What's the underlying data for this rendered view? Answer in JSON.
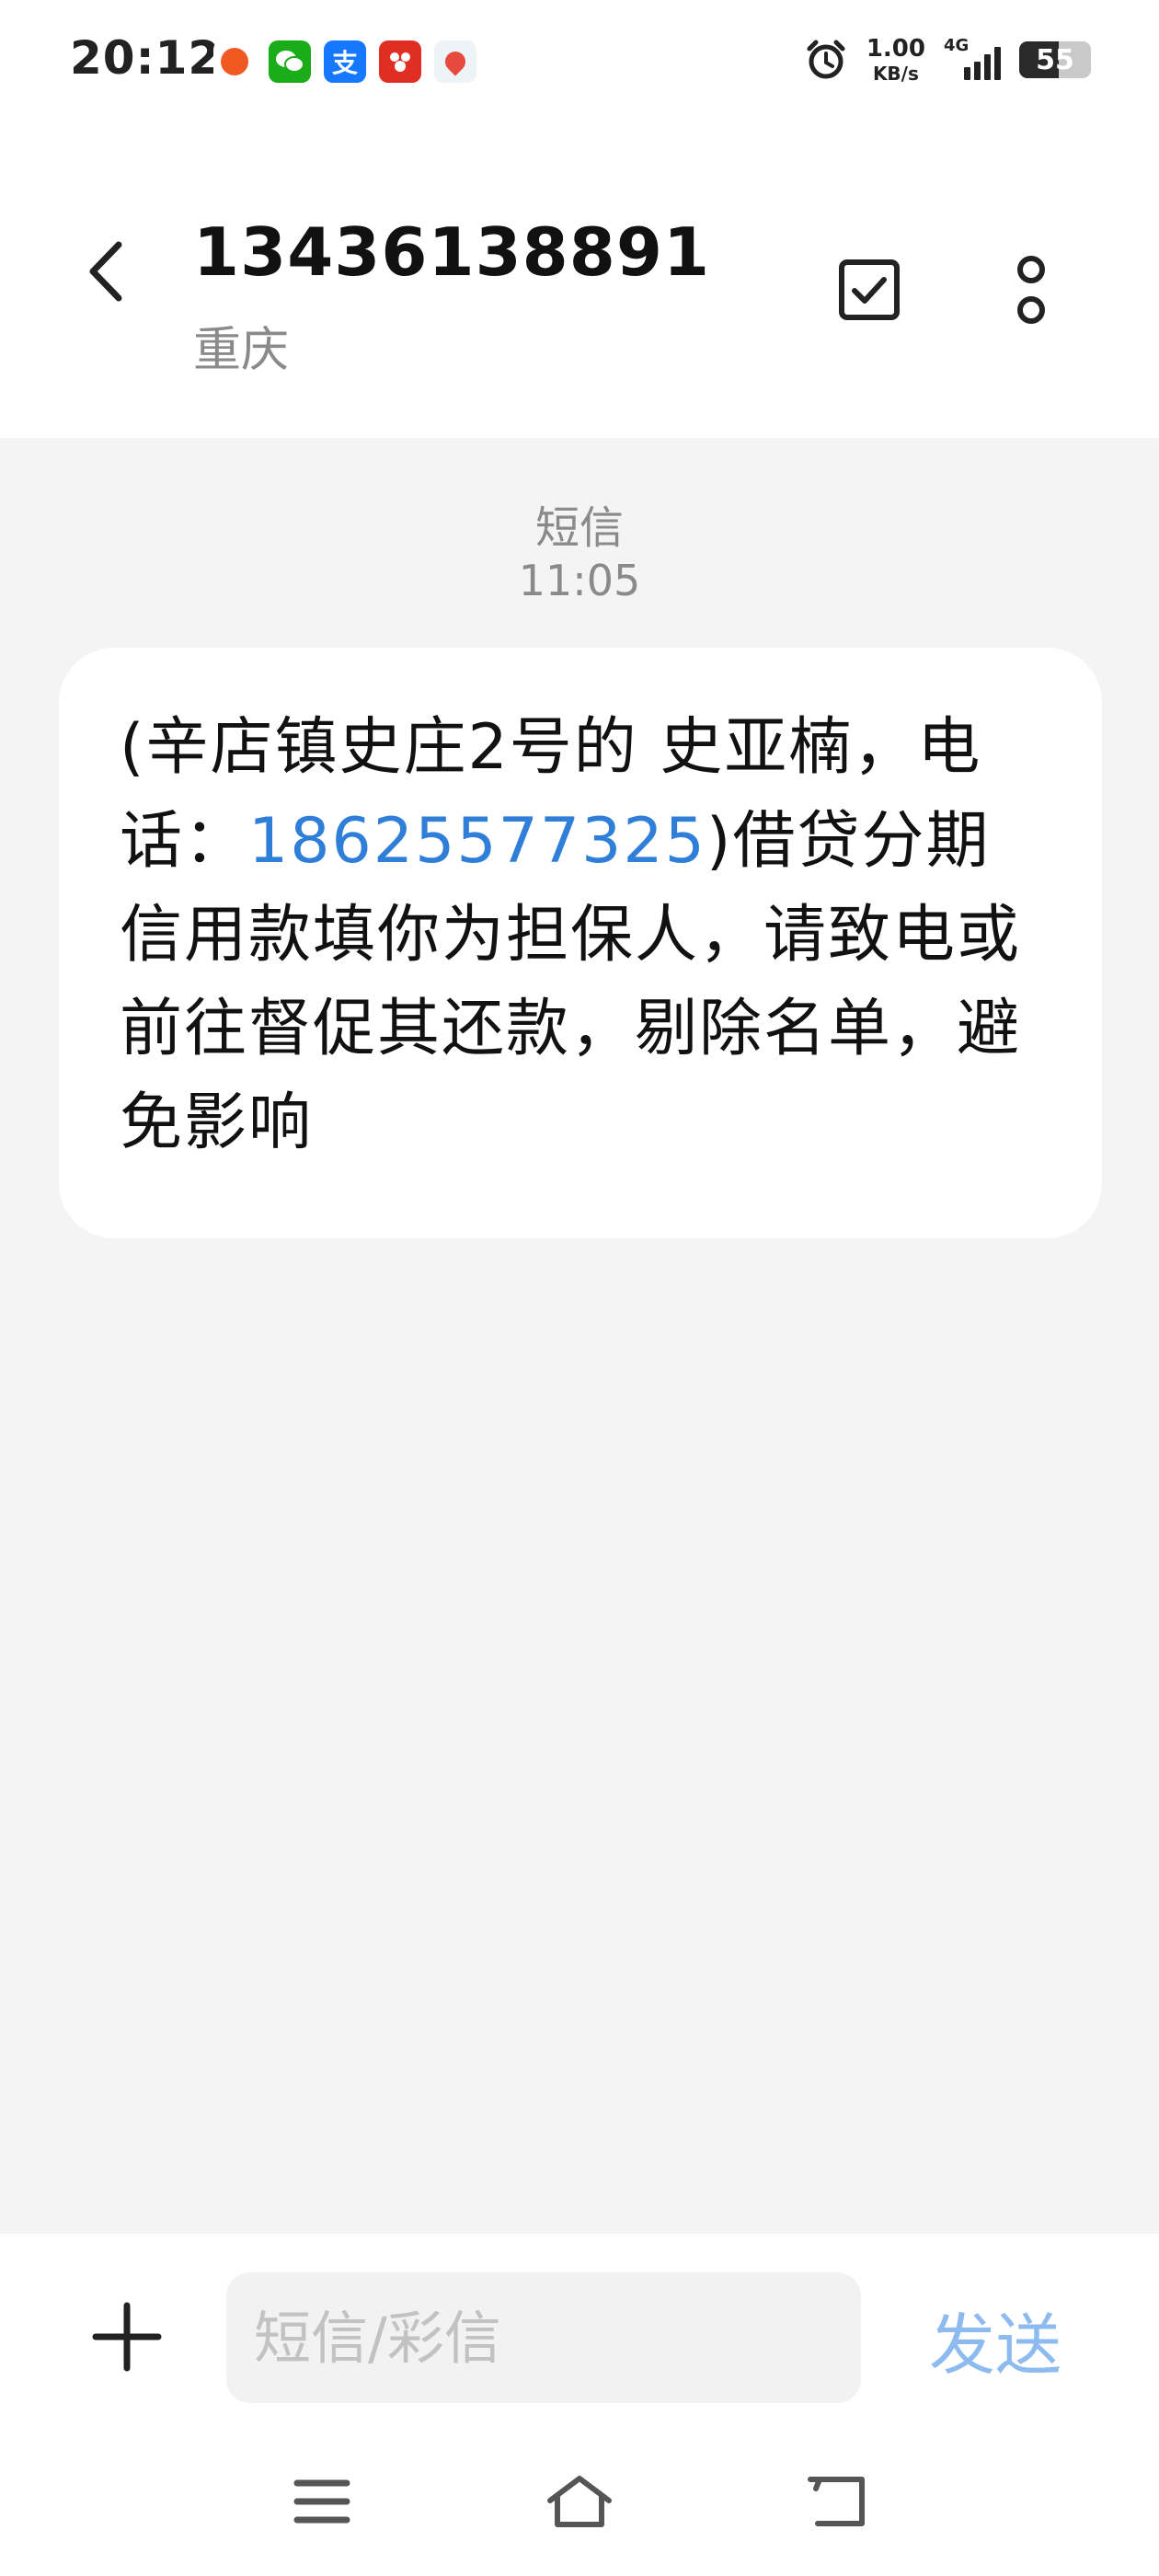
{
  "status_bar": {
    "time": "20:12",
    "net_speed_value": "1.00",
    "net_speed_unit": "KB/s",
    "network_type": "4G",
    "battery_level": "55",
    "notification_icons": [
      "orange-app-icon",
      "wechat-icon",
      "alipay-icon",
      "pinduoduo-icon",
      "map-icon"
    ]
  },
  "header": {
    "contact_number": "13436138891",
    "contact_location": "重庆",
    "icons": {
      "back": "back-arrow-icon",
      "select": "checkbox-icon",
      "more": "more-vertical-icon"
    }
  },
  "conversation": {
    "type_label": "短信",
    "time": "11:05",
    "message": {
      "text_before": "(辛店镇史庄2号的 史亚楠，电话：",
      "phone": "18625577325",
      "text_after": ")借贷分期信用款填你为担保人，请致电或前往督促其还款，剔除名单，避免影响"
    }
  },
  "input_bar": {
    "placeholder": "短信/彩信",
    "value": "",
    "send_label": "发送"
  },
  "colors": {
    "link": "#2f7fd8",
    "send_disabled": "#8ebbef",
    "background": "#f4f4f4",
    "bubble": "#ffffff"
  }
}
